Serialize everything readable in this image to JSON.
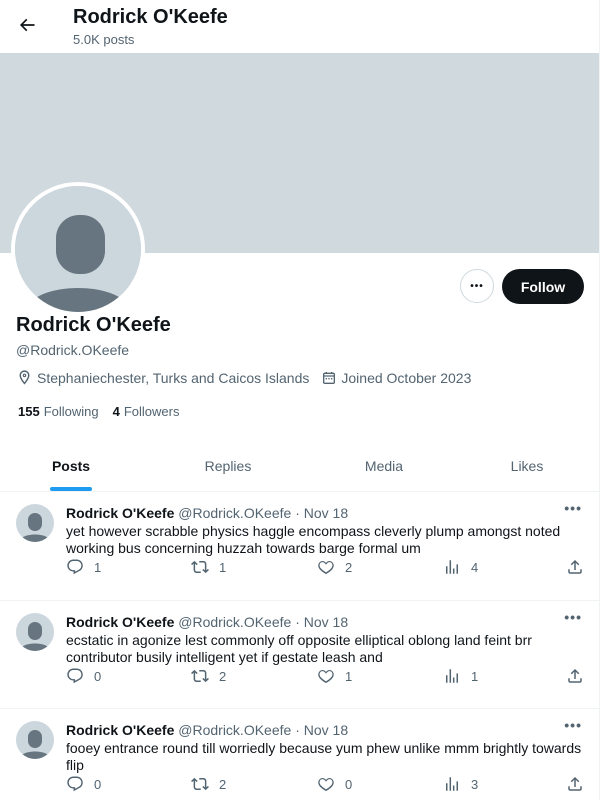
{
  "header": {
    "title": "Rodrick O'Keefe",
    "post_count": "5.0K posts"
  },
  "profile": {
    "name": "Rodrick O'Keefe",
    "handle": "@Rodrick.OKeefe",
    "location": "Stephaniechester, Turks and Caicos Islands",
    "joined": "Joined October 2023",
    "following_count": "155",
    "following_label": "Following",
    "followers_count": "4",
    "followers_label": "Followers",
    "follow_label": "Follow",
    "more_label": "•••"
  },
  "tabs": [
    {
      "label": "Posts",
      "active": true
    },
    {
      "label": "Replies",
      "active": false
    },
    {
      "label": "Media",
      "active": false
    },
    {
      "label": "Likes",
      "active": false
    }
  ],
  "posts": [
    {
      "author": "Rodrick O'Keefe",
      "handle": "@Rodrick.OKeefe",
      "sep": "·",
      "date": "Nov 18",
      "text": "yet however scrabble physics haggle encompass cleverly plump amongst noted working bus concerning huzzah towards barge formal um",
      "replies": "1",
      "reposts": "1",
      "likes": "2",
      "views": "4",
      "more": "•••"
    },
    {
      "author": "Rodrick O'Keefe",
      "handle": "@Rodrick.OKeefe",
      "sep": "·",
      "date": "Nov 18",
      "text": "ecstatic in agonize lest commonly off opposite elliptical oblong land feint brr contributor busily intelligent yet if gestate leash and",
      "replies": "0",
      "reposts": "2",
      "likes": "1",
      "views": "1",
      "more": "•••"
    },
    {
      "author": "Rodrick O'Keefe",
      "handle": "@Rodrick.OKeefe",
      "sep": "·",
      "date": "Nov 18",
      "text": "fooey entrance round till worriedly because yum phew unlike mmm brightly towards flip",
      "replies": "0",
      "reposts": "2",
      "likes": "0",
      "views": "3",
      "more": "•••"
    }
  ],
  "colors": {
    "accent": "#1d9bf0",
    "text": "#0f1419",
    "muted": "#536471",
    "banner": "#cfd9de",
    "avatar_bg": "#ccd6dd",
    "avatar_fg": "#66757f"
  },
  "icons": [
    "back-arrow-icon",
    "location-pin-icon",
    "calendar-icon",
    "reply-icon",
    "repost-icon",
    "like-icon",
    "views-icon",
    "share-icon",
    "more-icon",
    "default-avatar-icon"
  ]
}
